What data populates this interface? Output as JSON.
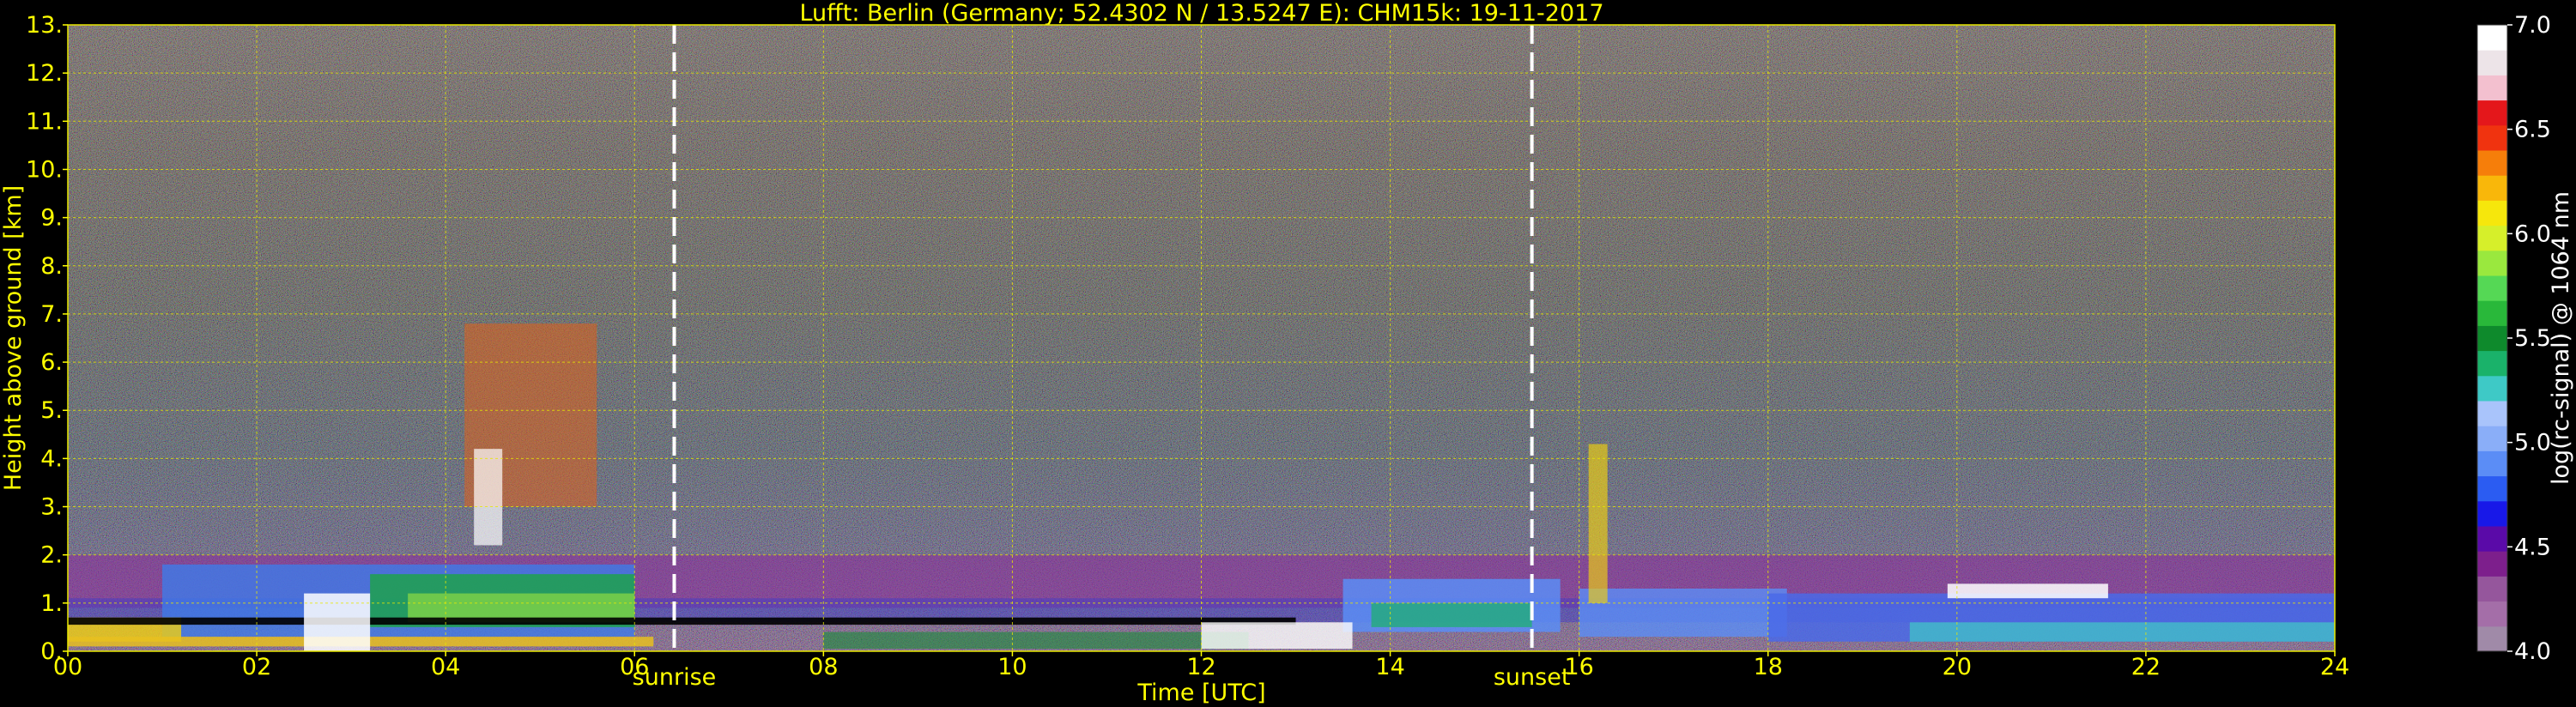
{
  "chart_data": {
    "type": "heatmap",
    "title": "Lufft: Berlin (Germany; 52.4302 N / 13.5247 E):    CHM15k: 19-11-2017",
    "xlabel": "Time [UTC]",
    "ylabel": "Height above ground [km]",
    "colorbar_label": "log(rc-signal) @ 1064 nm",
    "xlim": [
      0,
      24
    ],
    "ylim": [
      0,
      13
    ],
    "clim": [
      4.0,
      7.0
    ],
    "x_ticks": [
      0,
      2,
      4,
      6,
      8,
      10,
      12,
      14,
      16,
      18,
      20,
      22,
      24
    ],
    "x_tick_labels": [
      "00",
      "02",
      "04",
      "06",
      "08",
      "10",
      "12",
      "14",
      "16",
      "18",
      "20",
      "22",
      "24"
    ],
    "y_ticks": [
      0,
      1,
      2,
      3,
      4,
      5,
      6,
      7,
      8,
      9,
      10,
      11,
      12,
      13
    ],
    "y_tick_labels": [
      "0.",
      "1.",
      "2.",
      "3.",
      "4.",
      "5.",
      "6.",
      "7.",
      "8.",
      "9.",
      "10.",
      "11.",
      "12.",
      "13."
    ],
    "colorbar_ticks": [
      4.0,
      4.5,
      5.0,
      5.5,
      6.0,
      6.5,
      7.0
    ],
    "colorbar_tick_labels": [
      "4.0",
      "4.5",
      "5.0",
      "5.5",
      "6.0",
      "6.5",
      "7.0"
    ],
    "colorbar_colors": [
      "#a08aa8",
      "#a46ea8",
      "#95569c",
      "#7d1f8c",
      "#5a0aa8",
      "#1818e8",
      "#2b5cf2",
      "#5b8df6",
      "#8aaef8",
      "#a9c4fb",
      "#3ec9c6",
      "#1ab26a",
      "#0e8a2c",
      "#29b83a",
      "#55d855",
      "#9ae83e",
      "#d6ef2a",
      "#f6e70c",
      "#f9b70a",
      "#f67e0a",
      "#f0330f",
      "#e4171b",
      "#f3c0cf",
      "#ede4e8",
      "#ffffff"
    ],
    "annotations": [
      {
        "label": "sunrise",
        "x": 6.42
      },
      {
        "label": "sunset",
        "x": 15.5
      }
    ],
    "grid": true,
    "grid_color": "#e8e800",
    "text_color": "#ffff00",
    "colorbar_text_color": "#ffffff"
  }
}
